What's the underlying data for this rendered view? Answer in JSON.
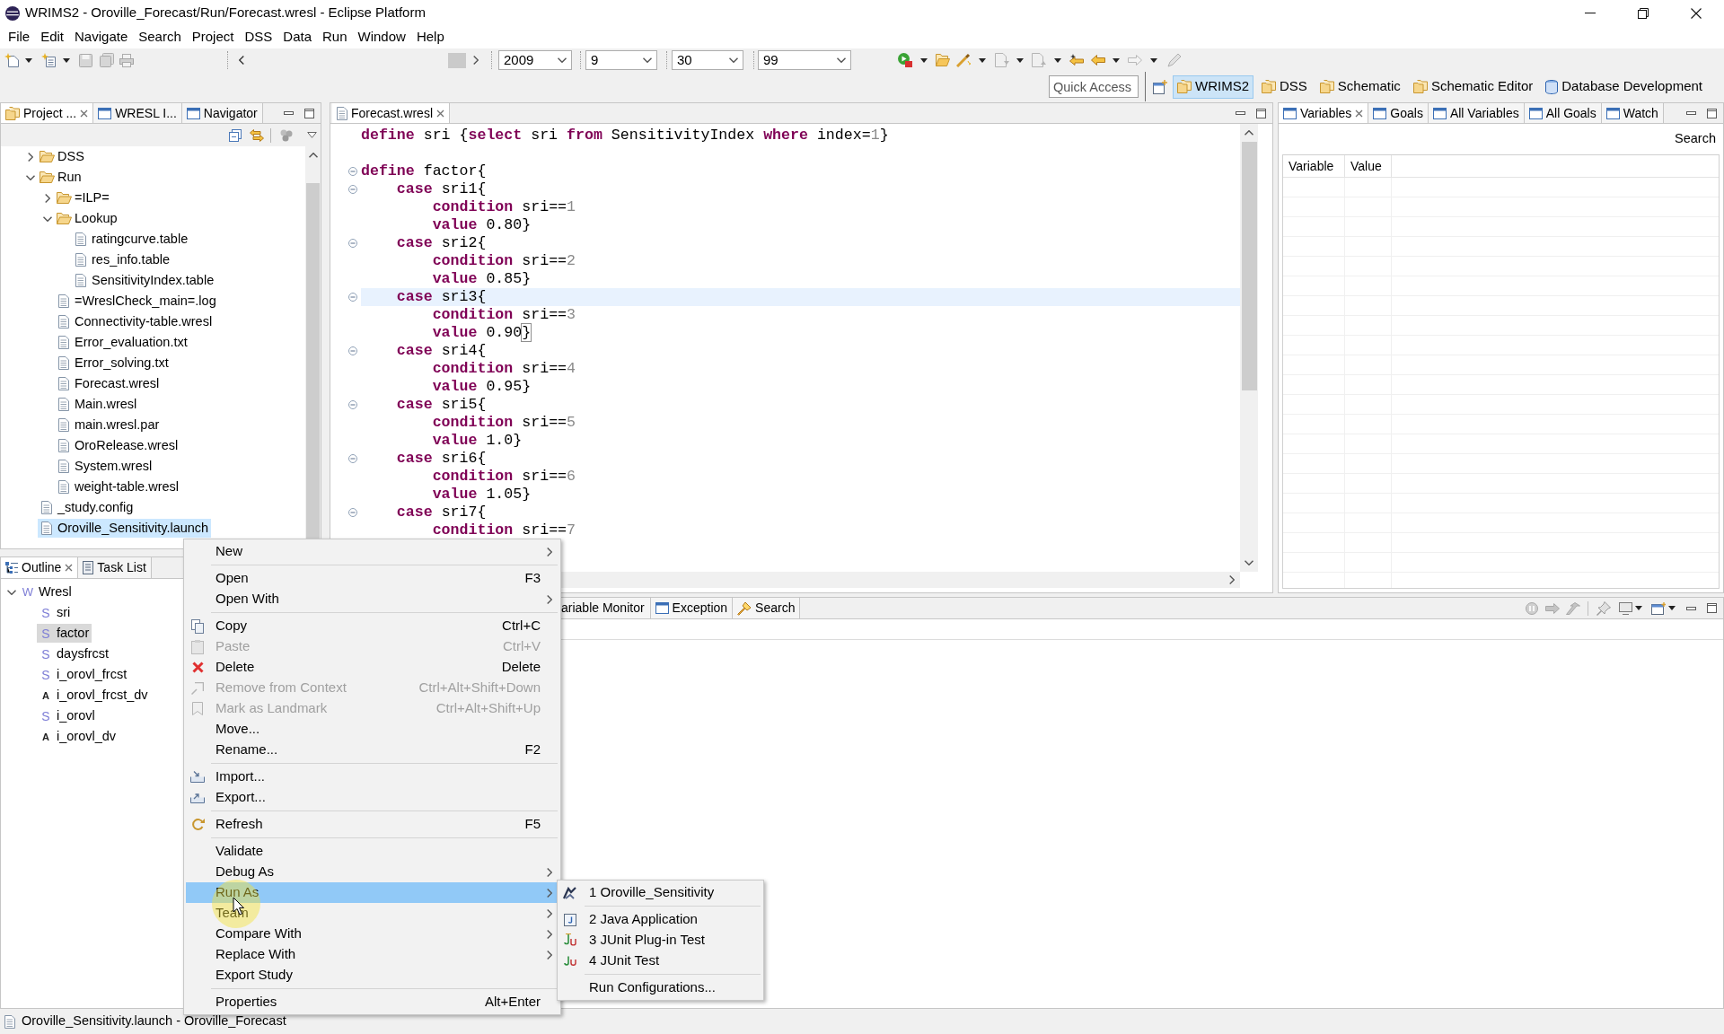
{
  "window": {
    "title": "WRIMS2 - Oroville_Forecast/Run/Forecast.wresl - Eclipse Platform"
  },
  "menu_bar": [
    "File",
    "Edit",
    "Navigate",
    "Search",
    "Project",
    "DSS",
    "Data",
    "Run",
    "Window",
    "Help"
  ],
  "toolbar": {
    "combos": [
      {
        "value": "2009"
      },
      {
        "value": "9"
      },
      {
        "value": "30"
      },
      {
        "value": "99"
      }
    ]
  },
  "quick_access": {
    "placeholder": "Quick Access"
  },
  "perspectives": [
    {
      "label": "WRIMS2",
      "kind": "folder",
      "selected": true
    },
    {
      "label": "DSS",
      "kind": "folder",
      "selected": false
    },
    {
      "label": "Schematic",
      "kind": "folder",
      "selected": false
    },
    {
      "label": "Schematic Editor",
      "kind": "folder",
      "selected": false
    },
    {
      "label": "Database Development",
      "kind": "database",
      "selected": false
    }
  ],
  "project_panel": {
    "tabs": [
      {
        "label": "Project ...",
        "kind": "project",
        "selected": true
      },
      {
        "label": "WRESL I...",
        "kind": "view",
        "selected": false
      },
      {
        "label": "Navigator",
        "kind": "view",
        "selected": false
      }
    ],
    "tree": [
      {
        "label": "DSS",
        "kind": "folder",
        "expanded": false,
        "selected": false
      },
      {
        "label": "Run",
        "kind": "folder",
        "expanded": true,
        "selected": false,
        "children": [
          {
            "label": "=ILP=",
            "kind": "folder",
            "expanded": false,
            "selected": false
          },
          {
            "label": "Lookup",
            "kind": "folder",
            "expanded": true,
            "selected": false,
            "children": [
              {
                "label": "ratingcurve.table",
                "kind": "file",
                "selected": false
              },
              {
                "label": "res_info.table",
                "kind": "file",
                "selected": false
              },
              {
                "label": "SensitivityIndex.table",
                "kind": "file",
                "selected": false
              }
            ]
          },
          {
            "label": "=WreslCheck_main=.log",
            "kind": "file",
            "selected": false
          },
          {
            "label": "Connectivity-table.wresl",
            "kind": "file",
            "selected": false
          },
          {
            "label": "Error_evaluation.txt",
            "kind": "file",
            "selected": false
          },
          {
            "label": "Error_solving.txt",
            "kind": "file",
            "selected": false
          },
          {
            "label": "Forecast.wresl",
            "kind": "file",
            "selected": false
          },
          {
            "label": "Main.wresl",
            "kind": "file",
            "selected": false
          },
          {
            "label": "main.wresl.par",
            "kind": "file",
            "selected": false
          },
          {
            "label": "OroRelease.wresl",
            "kind": "file",
            "selected": false
          },
          {
            "label": "System.wresl",
            "kind": "file",
            "selected": false
          },
          {
            "label": "weight-table.wresl",
            "kind": "file",
            "selected": false
          }
        ]
      },
      {
        "label": "_study.config",
        "kind": "file",
        "selected": false
      },
      {
        "label": "Oroville_Sensitivity.launch",
        "kind": "file",
        "selected": true
      }
    ]
  },
  "editor": {
    "tabs": [
      {
        "label": "Forecast.wresl",
        "kind": "file",
        "selected": true
      }
    ],
    "lines": [
      {
        "tokens": [
          {
            "text": "define",
            "kind": "keyword"
          },
          {
            "text": " sri {",
            "kind": "text"
          },
          {
            "text": "select",
            "kind": "keyword"
          },
          {
            "text": " sri ",
            "kind": "text"
          },
          {
            "text": "from",
            "kind": "keyword"
          },
          {
            "text": " SensitivityIndex ",
            "kind": "text"
          },
          {
            "text": "where",
            "kind": "keyword"
          },
          {
            "text": " index=",
            "kind": "text"
          },
          {
            "text": "1",
            "kind": "number"
          },
          {
            "text": "}",
            "kind": "text"
          }
        ],
        "fold": false,
        "current": false
      },
      {
        "fold": false,
        "current": false
      },
      {
        "tokens": [
          {
            "text": "define",
            "kind": "keyword"
          },
          {
            "text": " factor{",
            "kind": "text"
          }
        ],
        "fold": true,
        "current": false
      },
      {
        "tokens": [
          {
            "text": "    case",
            "kind": "keyword"
          },
          {
            "text": " sri1{",
            "kind": "text"
          }
        ],
        "fold": true,
        "current": false
      },
      {
        "tokens": [
          {
            "text": "        condition",
            "kind": "keyword"
          },
          {
            "text": " sri==",
            "kind": "text"
          },
          {
            "text": "1",
            "kind": "number"
          }
        ],
        "fold": false,
        "current": false
      },
      {
        "tokens": [
          {
            "text": "        value",
            "kind": "keyword"
          },
          {
            "text": " 0.80}",
            "kind": "text"
          }
        ],
        "fold": false,
        "current": false
      },
      {
        "tokens": [
          {
            "text": "    case",
            "kind": "keyword"
          },
          {
            "text": " sri2{",
            "kind": "text"
          }
        ],
        "fold": true,
        "current": false
      },
      {
        "tokens": [
          {
            "text": "        condition",
            "kind": "keyword"
          },
          {
            "text": " sri==",
            "kind": "text"
          },
          {
            "text": "2",
            "kind": "number"
          }
        ],
        "fold": false,
        "current": false
      },
      {
        "tokens": [
          {
            "text": "        value",
            "kind": "keyword"
          },
          {
            "text": " 0.85}",
            "kind": "text"
          }
        ],
        "fold": false,
        "current": false
      },
      {
        "tokens": [
          {
            "text": "    case",
            "kind": "keyword"
          },
          {
            "text": " sri3{",
            "kind": "text"
          }
        ],
        "fold": true,
        "current": true
      },
      {
        "tokens": [
          {
            "text": "        condition",
            "kind": "keyword"
          },
          {
            "text": " sri==",
            "kind": "text"
          },
          {
            "text": "3",
            "kind": "number"
          }
        ],
        "fold": false,
        "current": false
      },
      {
        "tokens": [
          {
            "text": "        value",
            "kind": "keyword"
          },
          {
            "text": " 0.90",
            "kind": "text"
          },
          {
            "text": "}",
            "kind": "matched"
          }
        ],
        "fold": false,
        "current": false
      },
      {
        "tokens": [
          {
            "text": "    case",
            "kind": "keyword"
          },
          {
            "text": " sri4{",
            "kind": "text"
          }
        ],
        "fold": true,
        "current": false
      },
      {
        "tokens": [
          {
            "text": "        condition",
            "kind": "keyword"
          },
          {
            "text": " sri==",
            "kind": "text"
          },
          {
            "text": "4",
            "kind": "number"
          }
        ],
        "fold": false,
        "current": false
      },
      {
        "tokens": [
          {
            "text": "        value",
            "kind": "keyword"
          },
          {
            "text": " 0.95}",
            "kind": "text"
          }
        ],
        "fold": false,
        "current": false
      },
      {
        "tokens": [
          {
            "text": "    case",
            "kind": "keyword"
          },
          {
            "text": " sri5{",
            "kind": "text"
          }
        ],
        "fold": true,
        "current": false
      },
      {
        "tokens": [
          {
            "text": "        condition",
            "kind": "keyword"
          },
          {
            "text": " sri==",
            "kind": "text"
          },
          {
            "text": "5",
            "kind": "number"
          }
        ],
        "fold": false,
        "current": false
      },
      {
        "tokens": [
          {
            "text": "        value",
            "kind": "keyword"
          },
          {
            "text": " 1.0}",
            "kind": "text"
          }
        ],
        "fold": false,
        "current": false
      },
      {
        "tokens": [
          {
            "text": "    case",
            "kind": "keyword"
          },
          {
            "text": " sri6{",
            "kind": "text"
          }
        ],
        "fold": true,
        "current": false
      },
      {
        "tokens": [
          {
            "text": "        condition",
            "kind": "keyword"
          },
          {
            "text": " sri==",
            "kind": "text"
          },
          {
            "text": "6",
            "kind": "number"
          }
        ],
        "fold": false,
        "current": false
      },
      {
        "tokens": [
          {
            "text": "        value",
            "kind": "keyword"
          },
          {
            "text": " 1.05}",
            "kind": "text"
          }
        ],
        "fold": false,
        "current": false
      },
      {
        "tokens": [
          {
            "text": "    case",
            "kind": "keyword"
          },
          {
            "text": " sri7{",
            "kind": "text"
          }
        ],
        "fold": true,
        "current": false
      },
      {
        "tokens": [
          {
            "text": "        condition",
            "kind": "keyword"
          },
          {
            "text": " sri==",
            "kind": "text"
          },
          {
            "text": "7",
            "kind": "number"
          }
        ],
        "fold": false,
        "current": false
      }
    ]
  },
  "variables_panel": {
    "tabs": [
      {
        "label": "Variables",
        "kind": "view",
        "selected": true
      },
      {
        "label": "Goals",
        "kind": "view",
        "selected": false
      },
      {
        "label": "All Variables",
        "kind": "view",
        "selected": false
      },
      {
        "label": "All Goals",
        "kind": "view",
        "selected": false
      },
      {
        "label": "Watch",
        "kind": "view",
        "selected": false
      }
    ],
    "search_link": "Search",
    "columns": [
      "Variable",
      "Value"
    ]
  },
  "outline_panel": {
    "tabs": [
      {
        "label": "Outline",
        "kind": "outline",
        "selected": true
      },
      {
        "label": "Task List",
        "kind": "tasks",
        "selected": false
      }
    ],
    "tree": [
      {
        "label": "Wresl",
        "letter": "W",
        "kind": "root",
        "expanded": true,
        "selected": false,
        "children": [
          {
            "label": "sri",
            "letter": "S",
            "kind": "svar",
            "selected": false
          },
          {
            "label": "factor",
            "letter": "S",
            "kind": "svar",
            "selected": true
          },
          {
            "label": "daysfrcst",
            "letter": "S",
            "kind": "svar",
            "selected": false
          },
          {
            "label": "i_orovl_frcst",
            "letter": "S",
            "kind": "svar",
            "selected": false
          },
          {
            "label": "i_orovl_frcst_dv",
            "letter": "A",
            "kind": "alias",
            "selected": false
          },
          {
            "label": "i_orovl",
            "letter": "S",
            "kind": "svar",
            "selected": false
          },
          {
            "label": "i_orovl_dv",
            "letter": "A",
            "kind": "alias",
            "selected": false
          }
        ]
      }
    ]
  },
  "debug_panel": {
    "tabs": [
      {
        "label": "ariable Monitor",
        "kind": "none",
        "selected": false
      },
      {
        "label": "Exception",
        "kind": "view",
        "selected": false
      },
      {
        "label": "Search",
        "kind": "search",
        "selected": false
      }
    ]
  },
  "context_menu": {
    "groups": [
      [
        {
          "label": "New",
          "kind": "plain",
          "submenu": true,
          "disabled": false,
          "selected": false
        }
      ],
      [
        {
          "label": "Open",
          "shortcut": "F3",
          "kind": "plain",
          "submenu": false,
          "disabled": false,
          "selected": false
        },
        {
          "label": "Open With",
          "kind": "plain",
          "submenu": true,
          "disabled": false,
          "selected": false
        }
      ],
      [
        {
          "label": "Copy",
          "shortcut": "Ctrl+C",
          "kind": "copy",
          "submenu": false,
          "disabled": false,
          "selected": false
        },
        {
          "label": "Paste",
          "shortcut": "Ctrl+V",
          "kind": "paste",
          "submenu": false,
          "disabled": true,
          "selected": false
        },
        {
          "label": "Delete",
          "shortcut": "Delete",
          "kind": "delete",
          "submenu": false,
          "disabled": false,
          "selected": false
        },
        {
          "label": "Remove from Context",
          "shortcut": "Ctrl+Alt+Shift+Down",
          "kind": "context",
          "submenu": false,
          "disabled": true,
          "selected": false
        },
        {
          "label": "Mark as Landmark",
          "shortcut": "Ctrl+Alt+Shift+Up",
          "kind": "landmark",
          "submenu": false,
          "disabled": true,
          "selected": false
        },
        {
          "label": "Move...",
          "kind": "plain",
          "submenu": false,
          "disabled": false,
          "selected": false
        },
        {
          "label": "Rename...",
          "shortcut": "F2",
          "kind": "plain",
          "submenu": false,
          "disabled": false,
          "selected": false
        }
      ],
      [
        {
          "label": "Import...",
          "kind": "import",
          "submenu": false,
          "disabled": false,
          "selected": false
        },
        {
          "label": "Export...",
          "kind": "export",
          "submenu": false,
          "disabled": false,
          "selected": false
        }
      ],
      [
        {
          "label": "Refresh",
          "shortcut": "F5",
          "kind": "refresh",
          "submenu": false,
          "disabled": false,
          "selected": false
        }
      ],
      [
        {
          "label": "Validate",
          "kind": "plain",
          "submenu": false,
          "disabled": false,
          "selected": false
        },
        {
          "label": "Debug As",
          "kind": "plain",
          "submenu": true,
          "disabled": false,
          "selected": false
        },
        {
          "label": "Run As",
          "kind": "plain",
          "submenu": true,
          "disabled": false,
          "selected": true
        },
        {
          "label": "Team",
          "kind": "plain",
          "submenu": true,
          "disabled": false,
          "selected": false
        },
        {
          "label": "Compare With",
          "kind": "plain",
          "submenu": true,
          "disabled": false,
          "selected": false
        },
        {
          "label": "Replace With",
          "kind": "plain",
          "submenu": true,
          "disabled": false,
          "selected": false
        },
        {
          "label": "Export Study",
          "kind": "plain",
          "submenu": false,
          "disabled": false,
          "selected": false
        }
      ],
      [
        {
          "label": "Properties",
          "shortcut": "Alt+Enter",
          "kind": "plain",
          "submenu": false,
          "disabled": false,
          "selected": false
        }
      ]
    ]
  },
  "submenu": {
    "groups": [
      [
        {
          "label": "1 Oroville_Sensitivity",
          "kind": "launch",
          "selected": false
        }
      ],
      [
        {
          "label": "2 Java Application",
          "kind": "java",
          "selected": false
        },
        {
          "label": "3 JUnit Plug-in Test",
          "kind": "junit-plugin",
          "selected": false
        },
        {
          "label": "4 JUnit Test",
          "kind": "junit",
          "selected": false
        }
      ],
      [
        {
          "label": "Run Configurations...",
          "kind": "plain",
          "selected": false
        }
      ]
    ]
  },
  "status_bar": {
    "text": "Oroville_Sensitivity.launch - Oroville_Forecast"
  }
}
